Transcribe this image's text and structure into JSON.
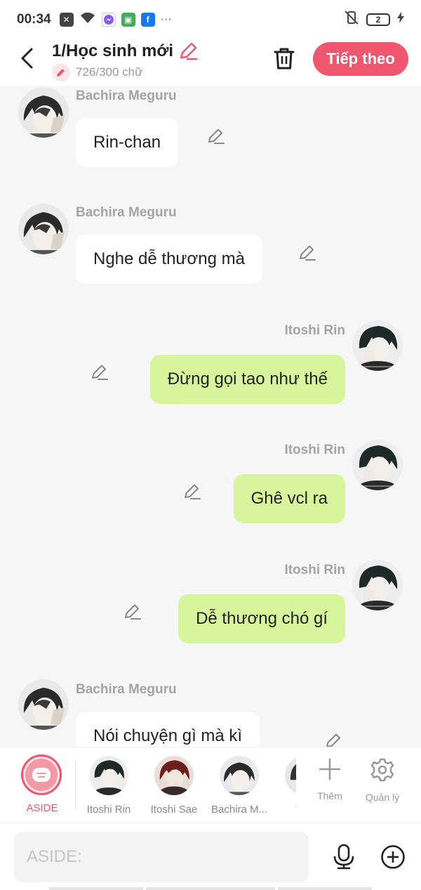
{
  "status_bar": {
    "time": "00:34",
    "battery": "2",
    "icons": [
      "close-box-icon",
      "wifi-icon",
      "messenger-icon",
      "app-icon",
      "facebook-icon",
      "more-dots-icon"
    ],
    "more": "···"
  },
  "header": {
    "title": "1/Học sinh mới",
    "word_count": "726/300 chữ",
    "next_label": "Tiếp theo",
    "accent": "#f0566e"
  },
  "messages": [
    {
      "side": "left",
      "sender": "Bachira Meguru",
      "text": "Rin-chan"
    },
    {
      "side": "left",
      "sender": "Bachira Meguru",
      "text": "Nghe dễ thương mà"
    },
    {
      "side": "right",
      "sender": "Itoshi Rin",
      "text": "Đừng gọi tao như thế"
    },
    {
      "side": "right",
      "sender": "Itoshi Rin",
      "text": "Ghê vcl ra"
    },
    {
      "side": "right",
      "sender": "Itoshi Rin",
      "text": "Dễ thương chó gí"
    },
    {
      "side": "left",
      "sender": "Bachira Meguru",
      "text": "Nói chuyện gì mà kì"
    }
  ],
  "character_bar": {
    "aside_label": "ASIDE",
    "characters": [
      "Itoshi Rin",
      "Itoshi Sae",
      "Bachira M...",
      "Thủ"
    ],
    "add_label": "Thêm",
    "manage_label": "Quản lý"
  },
  "input": {
    "placeholder": "ASIDE:"
  },
  "colors": {
    "accent": "#f0566e",
    "right_bubble": "#d7f59a",
    "left_bubble": "#ffffff",
    "chat_bg": "#f6f6f6"
  }
}
